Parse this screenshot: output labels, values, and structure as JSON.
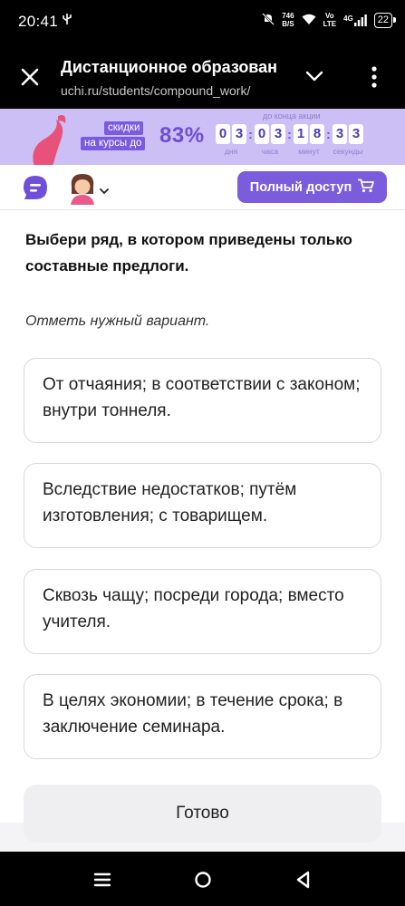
{
  "status_bar": {
    "time": "20:41",
    "left_icon": "usb-icon",
    "net_speed_value": "746",
    "net_speed_unit": "B/S",
    "volte_top": "Vo",
    "volte_bottom": "LTE",
    "network": "4G",
    "battery": "22"
  },
  "toolbar": {
    "title": "Дистанционное образован",
    "url": "uchi.ru/students/compound_work/"
  },
  "promo": {
    "label_line1": "скидки",
    "label_line2": "на курсы до",
    "percent": "83%",
    "until": "до конца акции",
    "timer": [
      {
        "digits": [
          "0",
          "3"
        ],
        "unit": "дня"
      },
      {
        "digits": [
          "0",
          "3"
        ],
        "unit": "часа"
      },
      {
        "digits": [
          "1",
          "8"
        ],
        "unit": "минут"
      },
      {
        "digits": [
          "3",
          "3"
        ],
        "unit": "секунды"
      }
    ],
    "accent_color": "#6a4fd4",
    "background_color": "#cbbff5"
  },
  "header": {
    "full_access_label": "Полный доступ",
    "button_color": "#7b5cdc"
  },
  "task": {
    "question": "Выбери ряд, в котором приведены только составные предлоги.",
    "hint": "Отметь нужный вариант.",
    "options": [
      "От отчаяния; в соответствии с законом; внутри тоннеля.",
      "Вследствие недостатков; путём изготовления; с товарищем.",
      "Сквозь чащу; посреди города; вместо учителя.",
      "В целях экономии; в течение срока; в заключение семинара."
    ],
    "done_label": "Готово"
  }
}
